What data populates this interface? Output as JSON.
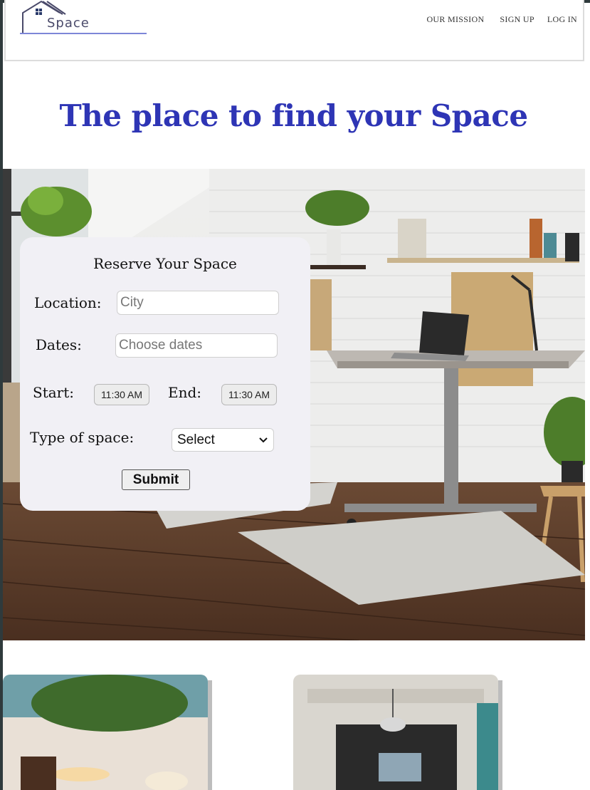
{
  "header": {
    "logo_text": "Space",
    "nav": [
      {
        "label": "OUR MISSION"
      },
      {
        "label": "SIGN UP"
      },
      {
        "label": "LOG IN"
      }
    ]
  },
  "hero": {
    "headline": "The place to find your Space"
  },
  "reservation_form": {
    "title": "Reserve Your Space",
    "location_label": "Location:",
    "location_placeholder": "City",
    "dates_label": "Dates:",
    "dates_placeholder": "Choose dates",
    "start_label": "Start:",
    "start_value": "11:30 AM",
    "end_label": "End:",
    "end_value": "11:30 AM",
    "type_label": "Type of space:",
    "type_selected": "Select",
    "submit_label": "Submit"
  },
  "colors": {
    "headline": "#2e35b5",
    "logo_line": "#7d86d8",
    "card_bg": "#f1f0f5"
  },
  "icons": {
    "logo": "house-roof-icon",
    "select": "chevron-down-icon"
  }
}
